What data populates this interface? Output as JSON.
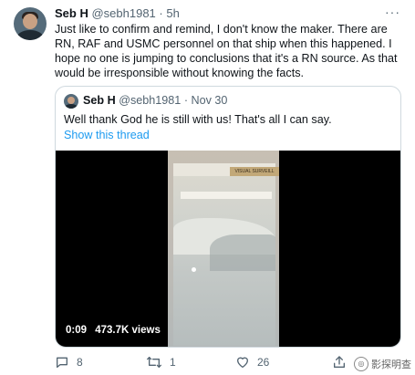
{
  "tweet": {
    "author_name": "Seb H",
    "author_handle": "@sebh1981",
    "time": "· 5h",
    "more": "···",
    "text": "Just like to confirm and remind, I don't know the maker. There are RN, RAF and USMC personnel on that ship when this happened. I hope no one is jumping to conclusions that it's a RN source. As that would be irresponsible without knowing the facts."
  },
  "quote": {
    "author_name": "Seb H",
    "author_handle": "@sebh1981",
    "time": "· Nov 30",
    "text": "Well thank God he is still with us! That's all I can say.",
    "show_thread": "Show this thread",
    "video": {
      "time": "0:09",
      "views": "473.7K views",
      "screen_label": "VISUAL SURVEILL"
    }
  },
  "actions": {
    "replies": "8",
    "retweets": "1",
    "likes": "26"
  },
  "watermark": "影探明查",
  "icons": {
    "reply": "comment-icon",
    "retweet": "retweet-icon",
    "like": "heart-icon",
    "share": "share-icon"
  }
}
